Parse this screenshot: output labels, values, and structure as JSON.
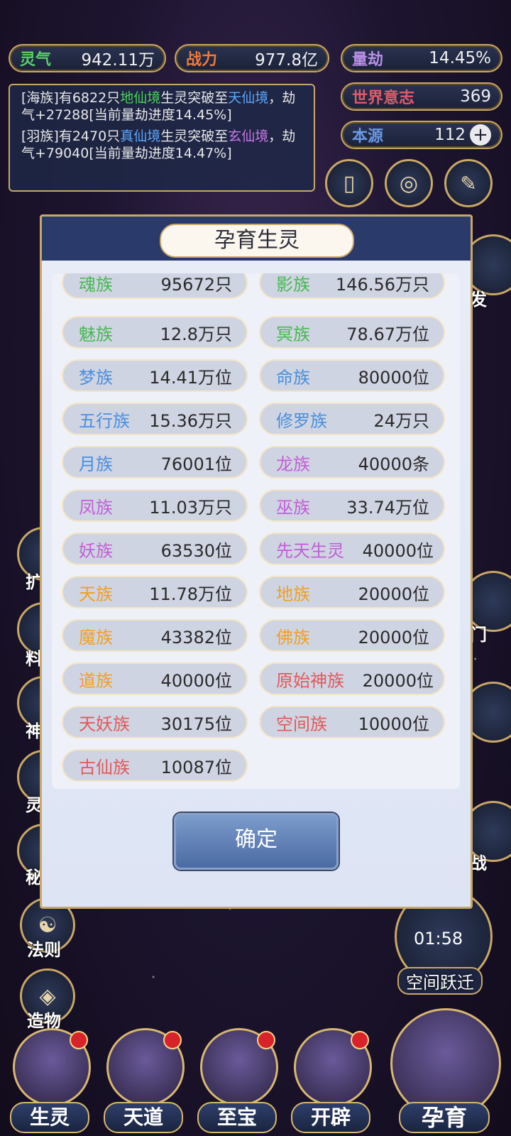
{
  "stats": [
    {
      "label": "灵气",
      "value": "942.11万",
      "color": "#5ad06a"
    },
    {
      "label": "战力",
      "value": "977.8亿",
      "color": "#f07a3a"
    },
    {
      "label": "量劫",
      "value": "14.45%",
      "color": "#b98fe6"
    },
    {
      "label": "世界意志",
      "value": "369",
      "color": "#e05a6a"
    },
    {
      "label": "本源",
      "value": "112",
      "color": "#6a9ae6"
    }
  ],
  "log": {
    "entry1": {
      "pre": "[海族]有6822只",
      "realm": "地仙境",
      "mid": "生灵突破至",
      "target": "天仙境",
      "post": "，劫气+27288[当前量劫进度14.45%]"
    },
    "entry2": {
      "pre": "[羽族]有2470只",
      "realm": "真仙境",
      "mid": "生灵突破至",
      "target": "玄仙境",
      "post": "，劫气+79040[当前量劫进度14.47%]"
    }
  },
  "side": {
    "right_top_label": "发",
    "right_mid_label": "门",
    "right_low_label": "战",
    "left_labels": [
      "扩",
      "料",
      "神",
      "灵",
      "秘"
    ],
    "rule_label": "法则",
    "create_label": "造物",
    "timer": "01:58",
    "jump_label": "空间跃迁"
  },
  "modal": {
    "title": "孕育生灵",
    "confirm": "确定",
    "races": [
      {
        "name": "魂族",
        "count": "95672只",
        "color": "#46b950"
      },
      {
        "name": "影族",
        "count": "146.56万只",
        "color": "#46b950"
      },
      {
        "name": "魅族",
        "count": "12.8万只",
        "color": "#46b950"
      },
      {
        "name": "冥族",
        "count": "78.67万位",
        "color": "#46b950"
      },
      {
        "name": "梦族",
        "count": "14.41万位",
        "color": "#4a8fdc"
      },
      {
        "name": "命族",
        "count": "80000位",
        "color": "#4a8fdc"
      },
      {
        "name": "五行族",
        "count": "15.36万只",
        "color": "#4a8fdc"
      },
      {
        "name": "修罗族",
        "count": "24万只",
        "color": "#4a8fdc"
      },
      {
        "name": "月族",
        "count": "76001位",
        "color": "#4a8fdc"
      },
      {
        "name": "龙族",
        "count": "40000条",
        "color": "#c25fd6"
      },
      {
        "name": "凤族",
        "count": "11.03万只",
        "color": "#c25fd6"
      },
      {
        "name": "巫族",
        "count": "33.74万位",
        "color": "#c25fd6"
      },
      {
        "name": "妖族",
        "count": "63530位",
        "color": "#c25fd6"
      },
      {
        "name": "先天生灵",
        "count": "40000位",
        "color": "#c25fd6"
      },
      {
        "name": "天族",
        "count": "11.78万位",
        "color": "#f0a020"
      },
      {
        "name": "地族",
        "count": "20000位",
        "color": "#f0a020"
      },
      {
        "name": "魔族",
        "count": "43382位",
        "color": "#f0a020"
      },
      {
        "name": "佛族",
        "count": "20000位",
        "color": "#f0a020"
      },
      {
        "name": "道族",
        "count": "40000位",
        "color": "#f0a020"
      },
      {
        "name": "原始神族",
        "count": "20000位",
        "color": "#e05a5a"
      },
      {
        "name": "天妖族",
        "count": "30175位",
        "color": "#e05a5a"
      },
      {
        "name": "空间族",
        "count": "10000位",
        "color": "#e05a5a"
      },
      {
        "name": "古仙族",
        "count": "10087位",
        "color": "#e05a5a"
      }
    ]
  },
  "bottom_nav": [
    {
      "label": "生灵"
    },
    {
      "label": "天道"
    },
    {
      "label": "至宝"
    },
    {
      "label": "开辟"
    },
    {
      "label": "孕育"
    }
  ]
}
